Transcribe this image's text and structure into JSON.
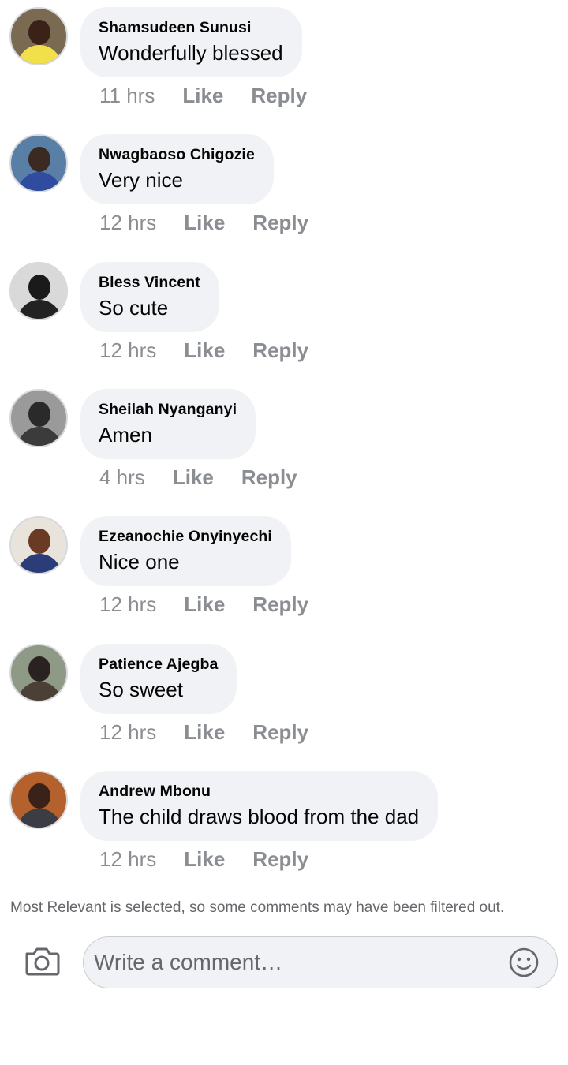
{
  "comments": [
    {
      "author": "Shamsudeen Sunusi",
      "text": "Wonderfully blessed",
      "time": "11 hrs",
      "like": "Like",
      "reply": "Reply",
      "avatar": {
        "bg": "#7a6a52",
        "face": "#3a2218",
        "body": "#f2e04a"
      }
    },
    {
      "author": "Nwagbaoso Chigozie",
      "text": "Very nice",
      "time": "12 hrs",
      "like": "Like",
      "reply": "Reply",
      "avatar": {
        "bg": "#5a7fa6",
        "face": "#3a2a22",
        "body": "#2f4c9e"
      }
    },
    {
      "author": "Bless Vincent",
      "text": "So cute",
      "time": "12 hrs",
      "like": "Like",
      "reply": "Reply",
      "avatar": {
        "bg": "#d9d9d9",
        "face": "#1a1a1a",
        "body": "#222222"
      }
    },
    {
      "author": "Sheilah Nyanganyi",
      "text": "Amen",
      "time": "4 hrs",
      "like": "Like",
      "reply": "Reply",
      "avatar": {
        "bg": "#9a9a9a",
        "face": "#2a2a2a",
        "body": "#3b3b3b"
      }
    },
    {
      "author": "Ezeanochie Onyinyechi",
      "text": "Nice one",
      "time": "12 hrs",
      "like": "Like",
      "reply": "Reply",
      "avatar": {
        "bg": "#e8e4dc",
        "face": "#6b3a24",
        "body": "#2b3d78"
      }
    },
    {
      "author": "Patience Ajegba",
      "text": "So sweet",
      "time": "12 hrs",
      "like": "Like",
      "reply": "Reply",
      "avatar": {
        "bg": "#8f9a86",
        "face": "#2a2220",
        "body": "#4a4036"
      }
    },
    {
      "author": "Andrew Mbonu",
      "text": "The child draws blood from the dad",
      "time": "12 hrs",
      "like": "Like",
      "reply": "Reply",
      "avatar": {
        "bg": "#b4612e",
        "face": "#3a2218",
        "body": "#3c3d44"
      }
    }
  ],
  "filter_note": "Most Relevant is selected, so some comments may have been filtered out.",
  "composer": {
    "placeholder": "Write a comment…",
    "camera_icon": "camera-icon",
    "emoji_icon": "emoji-smiley-icon"
  }
}
